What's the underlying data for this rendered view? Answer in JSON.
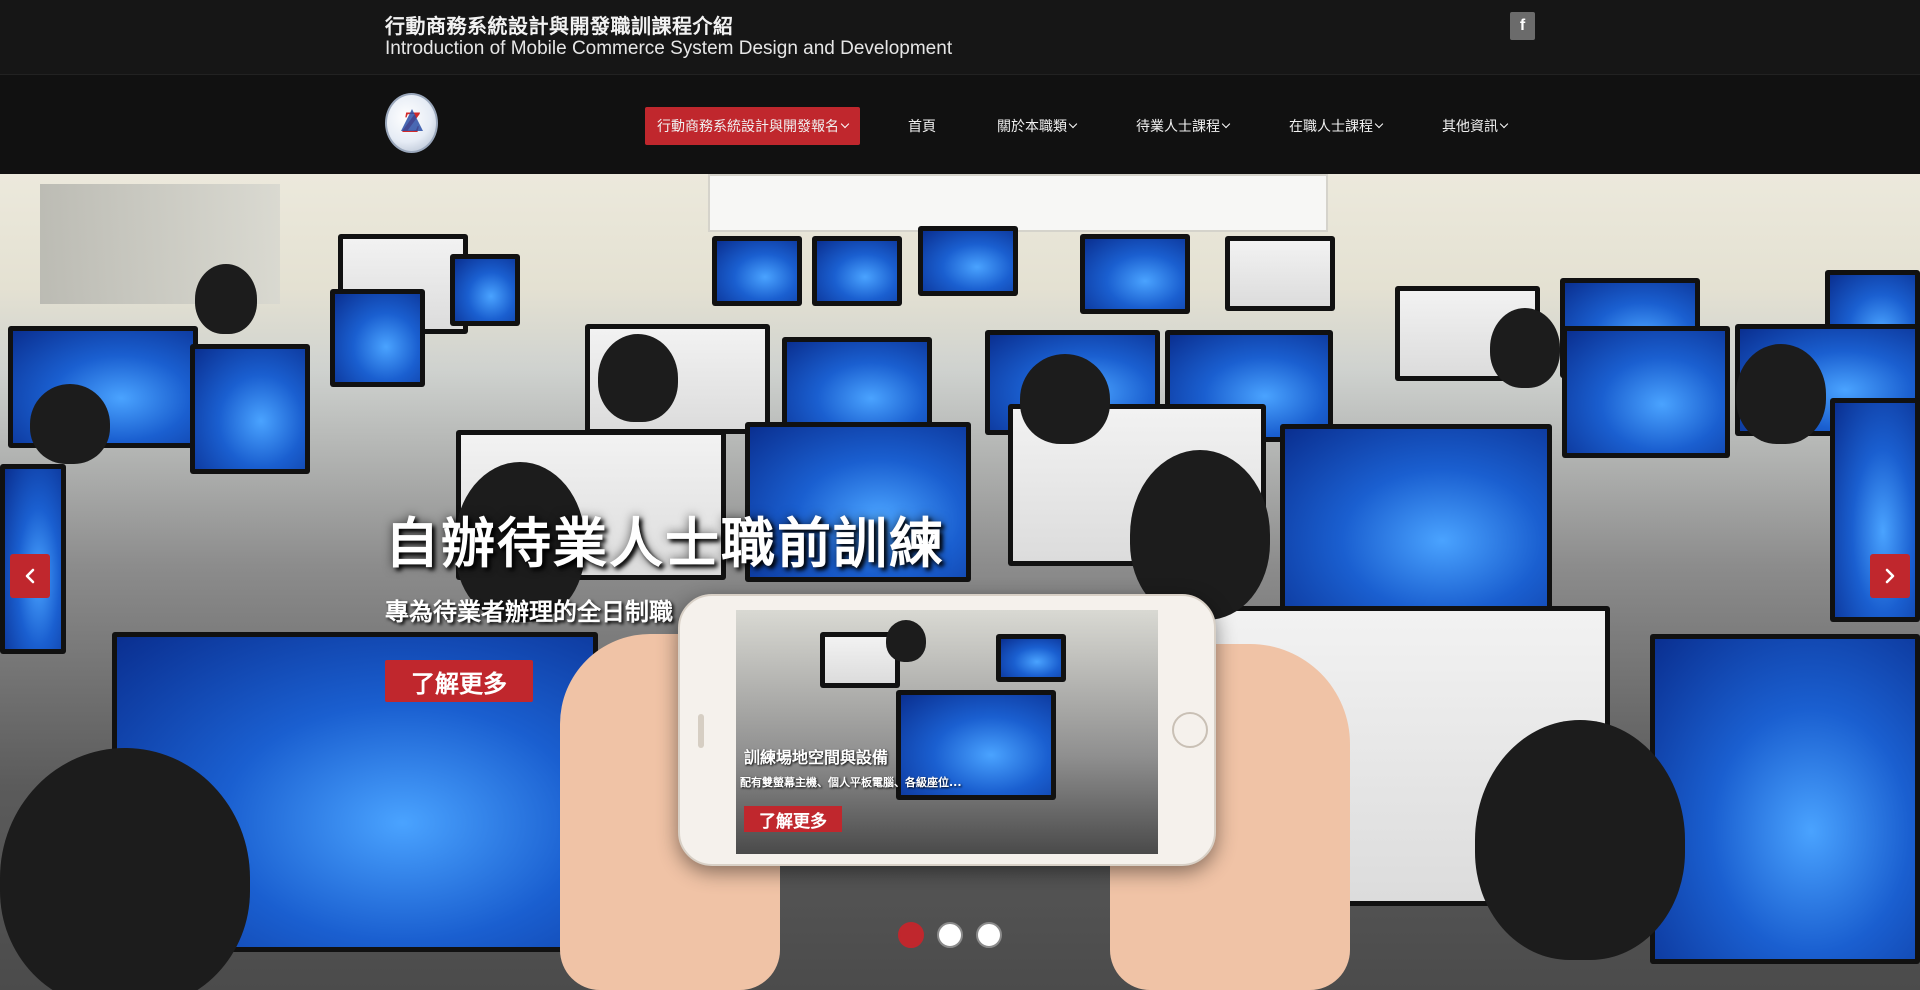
{
  "header": {
    "title_zh": "行動商務系統設計與開發職訓課程介紹",
    "title_en": "Introduction of Mobile Commerce System Design and Development",
    "facebook_label": "f"
  },
  "nav": {
    "items": [
      {
        "label": "行動商務系統設計與開發報名",
        "dropdown": true,
        "active": true
      },
      {
        "label": "首頁",
        "dropdown": false
      },
      {
        "label": "關於本職類",
        "dropdown": true
      },
      {
        "label": "待業人士課程",
        "dropdown": true
      },
      {
        "label": "在職人士課程",
        "dropdown": true
      },
      {
        "label": "其他資訊",
        "dropdown": true
      }
    ]
  },
  "hero": {
    "heading": "自辦待業人士職前訓練",
    "subheading": "專為待業者辦理的全日制職",
    "cta_label": "了解更多",
    "phone": {
      "caption": "訓練場地空間與設備",
      "caption_sub": "配有雙螢幕主機、個人平板電腦、各級座位...",
      "cta_label": "了解更多"
    },
    "slides_count": 3,
    "active_slide": 1
  },
  "colors": {
    "accent": "#c0272d",
    "topbar_bg": "#161616",
    "navbar_bg": "#111111"
  },
  "icons": [
    "facebook-icon",
    "chevron-down-icon",
    "chevron-left-icon",
    "chevron-right-icon"
  ]
}
